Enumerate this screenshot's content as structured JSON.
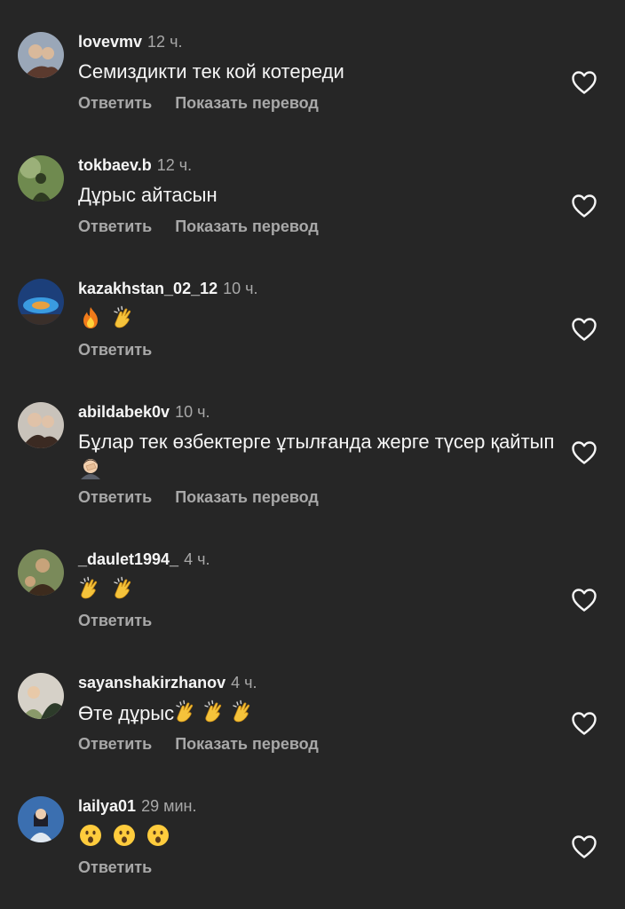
{
  "comments": [
    {
      "username": "lovevmv",
      "time": "12 ч.",
      "text": "Семиздикти тек кой котереди",
      "emojis": [],
      "actions": {
        "reply": "Ответить",
        "translate": "Показать перевод"
      },
      "avatar": {
        "bg": "#9aa7b8",
        "fg": "#5b3a2e",
        "fg2": "#d9b99b"
      }
    },
    {
      "username": "tokbaev.b",
      "time": "12 ч.",
      "text": "Дұрыс айтасын",
      "emojis": [],
      "actions": {
        "reply": "Ответить",
        "translate": "Показать перевод"
      },
      "avatar": {
        "bg": "#6f8a4f",
        "fg": "#2f3b22",
        "fg2": "#9bb079"
      }
    },
    {
      "username": "kazakhstan_02_12",
      "time": "10 ч.",
      "text": "",
      "emojis": [
        "fire-emoji",
        "clapping-hands-emoji"
      ],
      "actions": {
        "reply": "Ответить"
      },
      "avatar": {
        "bg": "#1c3f7a",
        "fg": "#3a9be0",
        "fg2": "#e8a040"
      }
    },
    {
      "username": "abildabek0v",
      "time": "10 ч.",
      "text": "Бұлар тек өзбектерге ұтылғанда жерге түсер қайтып",
      "emojis": [
        "person-facepalming-emoji"
      ],
      "actions": {
        "reply": "Ответить",
        "translate": "Показать перевод"
      },
      "avatar": {
        "bg": "#c9c3bb",
        "fg": "#3b2a22",
        "fg2": "#e0c2a8"
      }
    },
    {
      "username": "_daulet1994_",
      "time": "4 ч.",
      "text": "",
      "emojis": [
        "clapping-hands-emoji",
        "clapping-hands-emoji"
      ],
      "actions": {
        "reply": "Ответить"
      },
      "avatar": {
        "bg": "#7a8a5a",
        "fg": "#3d2b1d",
        "fg2": "#c7a37a"
      }
    },
    {
      "username": "sayanshakirzhanov",
      "time": "4 ч.",
      "text": "Өте дұрыс",
      "emojis": [
        "clapping-hands-emoji",
        "clapping-hands-emoji",
        "clapping-hands-emoji"
      ],
      "actions": {
        "reply": "Ответить",
        "translate": "Показать перевод"
      },
      "avatar": {
        "bg": "#d6d1c8",
        "fg": "#2d3b2a",
        "fg2": "#8a9a6a"
      }
    },
    {
      "username": "lailya01",
      "time": "29 мин.",
      "text": "",
      "emojis": [
        "face-with-open-mouth-emoji",
        "face-with-open-mouth-emoji",
        "face-with-open-mouth-emoji"
      ],
      "actions": {
        "reply": "Ответить"
      },
      "avatar": {
        "bg": "#3b6fb0",
        "fg": "#1f1f2a",
        "fg2": "#e0e8f0"
      }
    }
  ],
  "colors": {
    "background": "#262626",
    "primary_text": "#f5f5f5",
    "secondary_text": "#a8a8a8"
  }
}
